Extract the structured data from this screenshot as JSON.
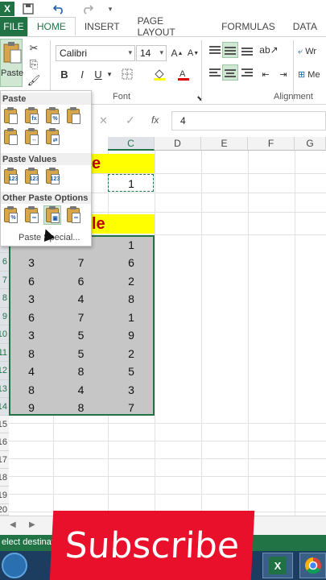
{
  "app": {
    "logo_label": "X",
    "tabs": [
      "FILE",
      "HOME",
      "INSERT",
      "PAGE LAYOUT",
      "FORMULAS",
      "DATA"
    ],
    "active_tab": "HOME"
  },
  "ribbon": {
    "paste_label": "Paste",
    "font_name": "Calibri",
    "font_size": "14",
    "font_group_label": "Font",
    "alignment_group_label": "Alignment",
    "wrap_label": "Wr",
    "merge_label": "Me",
    "bold": "B",
    "italic": "I",
    "underline": "U"
  },
  "formula_bar": {
    "cancel": "✕",
    "enter": "✓",
    "fx": "fx",
    "value": "4"
  },
  "columns": [
    "C",
    "D",
    "E",
    "F",
    "G"
  ],
  "header_cells": {
    "row2_text": "e",
    "row2_value": "1",
    "row4_text": "le"
  },
  "rows": [
    {
      "label": "",
      "a": "",
      "b": "",
      "c": "1"
    },
    {
      "label": "6",
      "a": "3",
      "b": "7",
      "c": "6"
    },
    {
      "label": "7",
      "a": "6",
      "b": "6",
      "c": "2"
    },
    {
      "label": "8",
      "a": "3",
      "b": "4",
      "c": "8"
    },
    {
      "label": "9",
      "a": "6",
      "b": "7",
      "c": "1"
    },
    {
      "label": "10",
      "a": "3",
      "b": "5",
      "c": "9"
    },
    {
      "label": "11",
      "a": "8",
      "b": "5",
      "c": "2"
    },
    {
      "label": "12",
      "a": "4",
      "b": "8",
      "c": "5"
    },
    {
      "label": "13",
      "a": "8",
      "b": "4",
      "c": "3"
    },
    {
      "label": "14",
      "a": "9",
      "b": "8",
      "c": "7"
    },
    {
      "label": "15",
      "a": "",
      "b": "",
      "c": ""
    },
    {
      "label": "16",
      "a": "",
      "b": "",
      "c": ""
    },
    {
      "label": "17",
      "a": "",
      "b": "",
      "c": ""
    },
    {
      "label": "18",
      "a": "",
      "b": "",
      "c": ""
    },
    {
      "label": "19",
      "a": "",
      "b": "",
      "c": ""
    },
    {
      "label": "20",
      "a": "",
      "b": "",
      "c": ""
    }
  ],
  "paste_menu": {
    "paste_heading": "Paste",
    "paste_values_heading": "Paste Values",
    "other_heading": "Other Paste Options",
    "paste_special": "Paste Special..."
  },
  "status": {
    "text": "elect destinati"
  },
  "overlay": {
    "subscribe": "Subscribe"
  },
  "colors": {
    "excel_green": "#217346",
    "yellow": "#ffff00",
    "header_red": "#c00000",
    "subscribe_red": "#e8102a"
  }
}
